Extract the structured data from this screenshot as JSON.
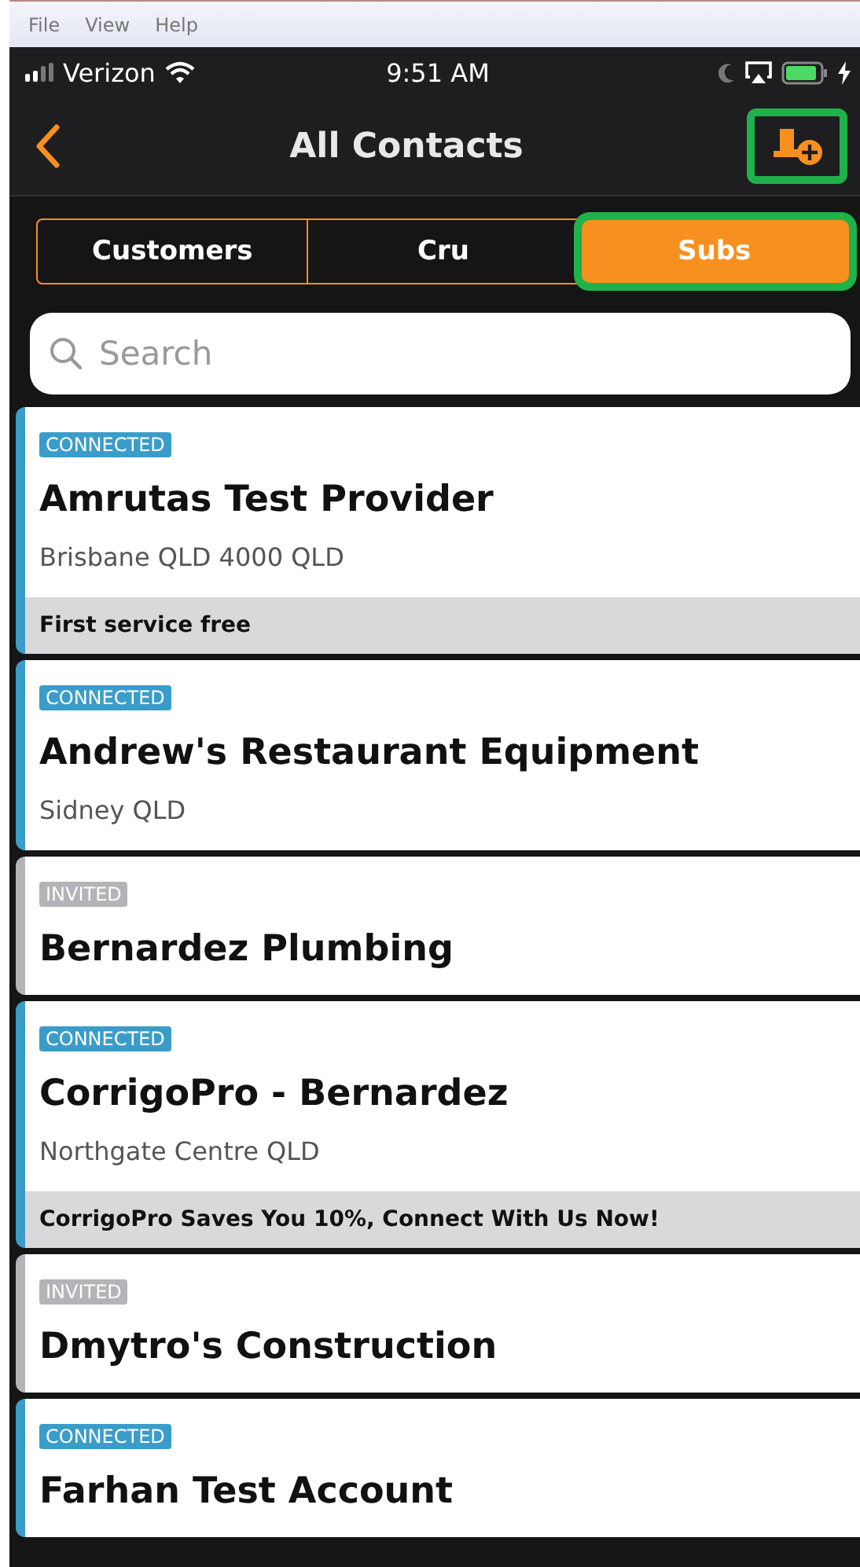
{
  "menu_bar": [
    "File",
    "View",
    "Help"
  ],
  "status_bar": {
    "carrier": "Verizon",
    "time": "9:51 AM"
  },
  "nav": {
    "title": "All Contacts",
    "add_highlighted": true
  },
  "tabs": [
    {
      "label": "Customers",
      "selected": false,
      "highlighted": false
    },
    {
      "label": "Cru",
      "selected": false,
      "highlighted": false
    },
    {
      "label": "Subs",
      "selected": true,
      "highlighted": true
    }
  ],
  "search": {
    "placeholder": "Search"
  },
  "contacts": [
    {
      "kind": "connected",
      "badge": "CONNECTED",
      "name": "Amrutas Test Provider",
      "address": "Brisbane QLD 4000 QLD",
      "promo": "First service free"
    },
    {
      "kind": "connected",
      "badge": "CONNECTED",
      "name": "Andrew's Restaurant Equipment",
      "address": "Sidney QLD"
    },
    {
      "kind": "invited",
      "badge": "INVITED",
      "name": "Bernardez Plumbing"
    },
    {
      "kind": "connected",
      "badge": "CONNECTED",
      "name": "CorrigoPro - Bernardez",
      "address": "Northgate Centre QLD",
      "promo": "CorrigoPro Saves You 10%, Connect With Us Now!"
    },
    {
      "kind": "invited",
      "badge": "INVITED",
      "name": "Dmytro's Construction"
    },
    {
      "kind": "connected",
      "badge": "CONNECTED",
      "name": "Farhan Test Account"
    }
  ]
}
